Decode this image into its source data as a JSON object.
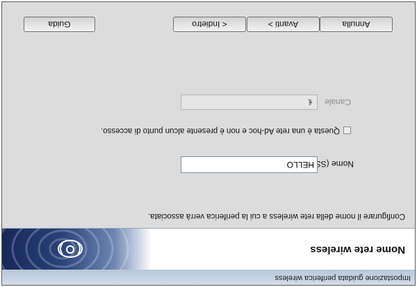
{
  "window": {
    "title": "Impostazione guidata periferica wireless",
    "banner_title": "Nome rete wireless"
  },
  "form": {
    "instruction": "Configurare il nome della rete wireless a cui la periferica verrà associata.",
    "ssid_label": "Nome (SSID)",
    "ssid_value": "HELLO",
    "adhoc_label": "Questa è una rete Ad-hoc e non è presente alcun punto di accesso.",
    "adhoc_checked": false,
    "channel_label": "Canale",
    "channel_value": "1"
  },
  "buttons": {
    "help": "Guida",
    "back": "< Indietro",
    "next": "Avanti >",
    "cancel": "Annulla"
  },
  "icons": {
    "banner": "wireless-signal-icon",
    "dropdown": "chevron-down-icon"
  },
  "colors": {
    "dialog_bg": "#dcdcdc",
    "banner_art": "#1e3569"
  }
}
